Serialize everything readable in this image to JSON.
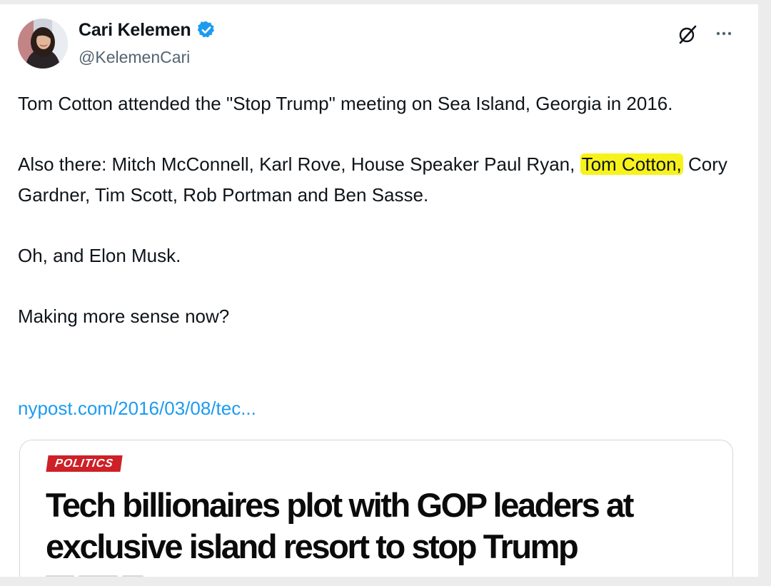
{
  "author": {
    "display_name": "Cari Kelemen",
    "handle": "@KelemenCari",
    "verified": true,
    "verified_badge_color": "#1d9bf0"
  },
  "header_actions": {
    "grok_icon": "grok-icon",
    "more_icon": "more-icon"
  },
  "tweet": {
    "para1": "Tom Cotton attended the \"Stop Trump\" meeting on Sea Island, Georgia in 2016.",
    "para2_before": "Also there: Mitch McConnell, Karl Rove, House Speaker Paul Ryan, ",
    "para2_highlight": "Tom Cotton,",
    "para2_after": " Cory Gardner, Tim Scott, Rob Portman and Ben Sasse.",
    "para3": "Oh, and Elon Musk.",
    "para4": "Making more sense now?",
    "link": "nypost.com/2016/03/08/tec..."
  },
  "embed": {
    "tag": "POLITICS",
    "headline": "Tech billionaires plot with GOP leaders at exclusive island resort to stop Trump"
  },
  "colors": {
    "highlight": "#f7f21c",
    "link": "#1d9bf0",
    "tag_bg": "#cd2027"
  }
}
